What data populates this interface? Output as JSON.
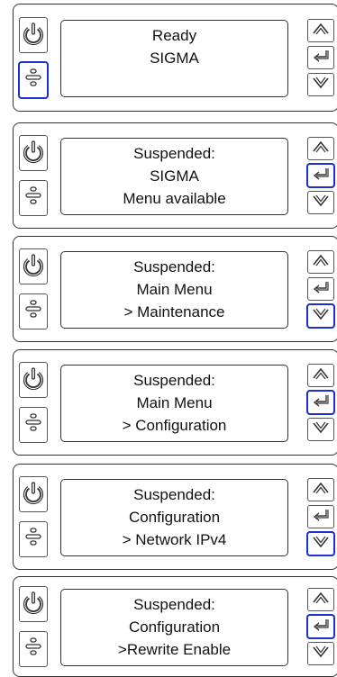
{
  "panels": [
    {
      "lines": [
        "Ready",
        "SIGMA",
        ""
      ],
      "highlight": "menu"
    },
    {
      "lines": [
        "Suspended:",
        "SIGMA",
        "Menu available"
      ],
      "highlight": "enter"
    },
    {
      "lines": [
        "Suspended:",
        "Main Menu",
        "> Maintenance"
      ],
      "highlight": "down"
    },
    {
      "lines": [
        "Suspended:",
        "Main Menu",
        "> Configuration"
      ],
      "highlight": "enter"
    },
    {
      "lines": [
        "Suspended:",
        "Configuration",
        "> Network IPv4"
      ],
      "highlight": "down"
    },
    {
      "lines": [
        "Suspended:",
        "Configuration",
        ">Rewrite Enable"
      ],
      "highlight": "enter"
    }
  ],
  "icons": {
    "power": "power-icon",
    "menu": "menu-icon",
    "up": "chevron-up-icon",
    "enter": "enter-icon",
    "down": "chevron-down-icon"
  },
  "colors": {
    "highlight": "#1a2fd6",
    "border": "#333333"
  }
}
